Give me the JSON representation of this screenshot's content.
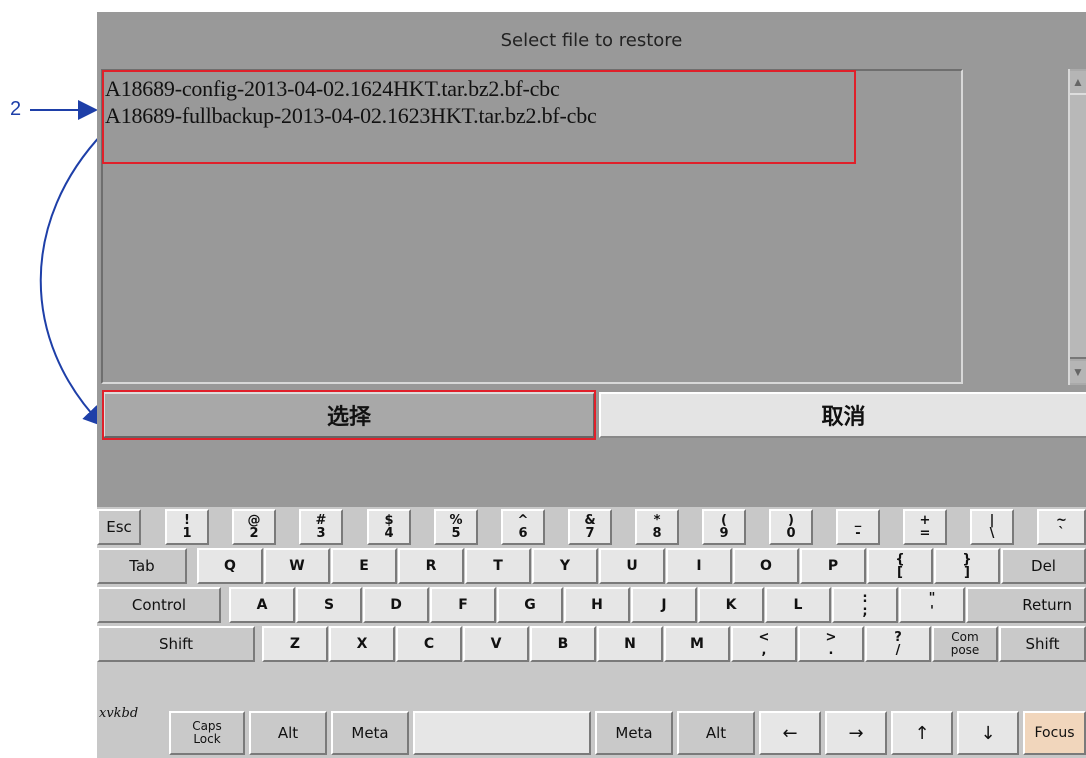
{
  "dialog": {
    "title": "Select file to restore",
    "files": [
      "A18689-config-2013-04-02.1624HKT.tar.bz2.bf-cbc",
      "A18689-fullbackup-2013-04-02.1623HKT.tar.bz2.bf-cbc"
    ],
    "select_label": "选择",
    "cancel_label": "取消"
  },
  "annotation": {
    "step_number": "2",
    "highlight_color": "#e0202a",
    "arrow_color": "#1e3fa8"
  },
  "keyboard": {
    "brand": "xvkbd",
    "row1": [
      {
        "label": "Esc"
      },
      {
        "top": "!",
        "bot": "1"
      },
      {
        "top": "@",
        "bot": "2"
      },
      {
        "top": "#",
        "bot": "3"
      },
      {
        "top": "$",
        "bot": "4"
      },
      {
        "top": "%",
        "bot": "5"
      },
      {
        "top": "^",
        "bot": "6"
      },
      {
        "top": "&",
        "bot": "7"
      },
      {
        "top": "*",
        "bot": "8"
      },
      {
        "top": "(",
        "bot": "9"
      },
      {
        "top": ")",
        "bot": "0"
      },
      {
        "top": "_",
        "bot": "-"
      },
      {
        "top": "+",
        "bot": "="
      },
      {
        "top": "|",
        "bot": "\\"
      },
      {
        "top": "~",
        "bot": "`"
      }
    ],
    "row2": [
      "Tab",
      "Q",
      "W",
      "E",
      "R",
      "T",
      "Y",
      "U",
      "I",
      "O",
      "P",
      "{[",
      "}]",
      "Del"
    ],
    "row2_brackets": [
      {
        "top": "{",
        "bot": "["
      },
      {
        "top": "}",
        "bot": "]"
      }
    ],
    "row3": [
      "Control",
      "A",
      "S",
      "D",
      "F",
      "G",
      "H",
      "J",
      "K",
      "L",
      "Return"
    ],
    "row3_punct": [
      {
        "top": ":",
        "bot": ";"
      },
      {
        "top": "\"",
        "bot": "'"
      }
    ],
    "row4": [
      "Shift",
      "Z",
      "X",
      "C",
      "V",
      "B",
      "N",
      "M",
      "Shift"
    ],
    "row4_punct": [
      {
        "top": "<",
        "bot": ","
      },
      {
        "top": ">",
        "bot": "."
      },
      {
        "top": "?",
        "bot": "/"
      }
    ],
    "compose": {
      "top": "Com",
      "bot": "pose"
    },
    "caps": {
      "top": "Caps",
      "bot": "Lock"
    },
    "row5": {
      "alt": "Alt",
      "meta": "Meta",
      "left": "←",
      "right": "→",
      "up": "↑",
      "down": "↓",
      "focus": "Focus"
    }
  }
}
